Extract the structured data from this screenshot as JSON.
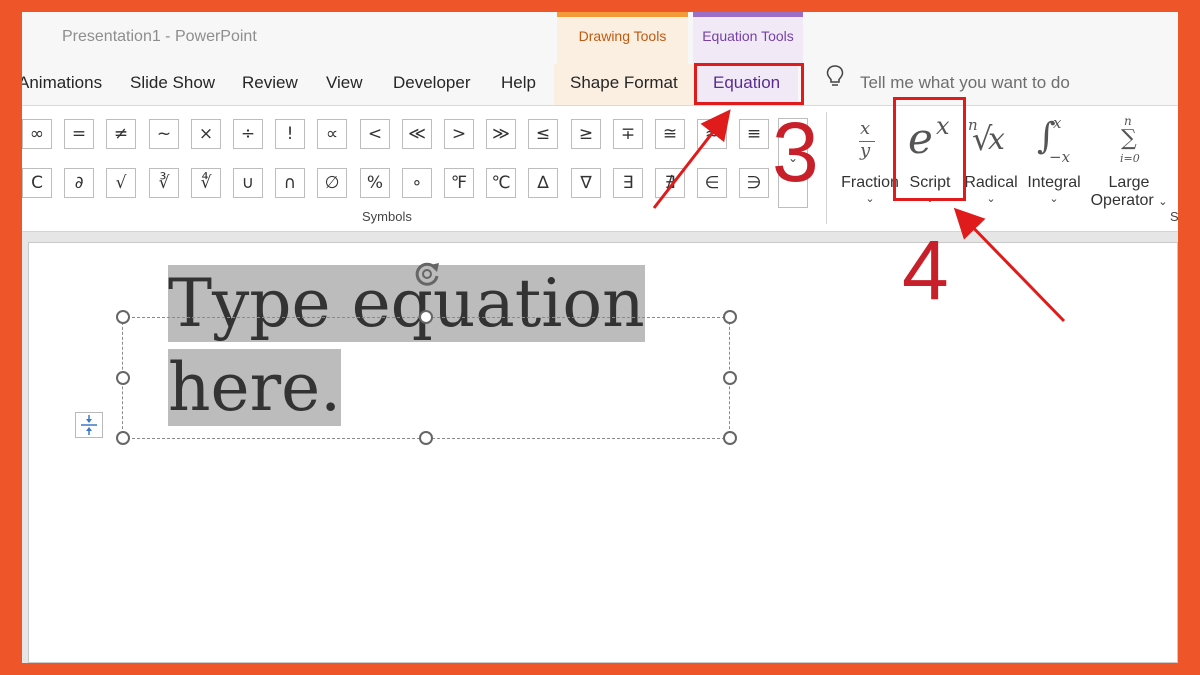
{
  "window": {
    "title": "Presentation1  -  PowerPoint"
  },
  "context_groups": {
    "drawing_tools": "Drawing Tools",
    "equation_tools": "Equation Tools"
  },
  "tabs": {
    "animations": "Animations",
    "slide_show": "Slide Show",
    "review": "Review",
    "view": "View",
    "developer": "Developer",
    "help": "Help",
    "shape_format": "Shape Format",
    "equation": "Equation"
  },
  "tell_me": {
    "placeholder": "Tell me what you want to do",
    "icon": "lightbulb-icon"
  },
  "symbols": {
    "row1": [
      "∞",
      "=",
      "≠",
      "~",
      "×",
      "÷",
      "!",
      "∝",
      "<",
      "≪",
      ">",
      "≫",
      "≤",
      "≥",
      "∓",
      "≅",
      "≈",
      "≡"
    ],
    "row2": [
      "C",
      "∂",
      "√",
      "∛",
      "∜",
      "∪",
      "∩",
      "∅",
      "%",
      "∘",
      "℉",
      "℃",
      "∆",
      "∇",
      "∃",
      "∄",
      "∈",
      "∋"
    ],
    "group_label": "Symbols"
  },
  "structures": {
    "fraction": {
      "label": "Fraction"
    },
    "script": {
      "label": "Script"
    },
    "radical": {
      "label": "Radical"
    },
    "integral": {
      "label": "Integral"
    },
    "large_operator": {
      "label_line1": "Large",
      "label_line2": "Operator"
    },
    "group_label": "S"
  },
  "equation_placeholder": "Type equation here.",
  "annotations": {
    "step3": "3",
    "step4": "4",
    "highlight_color": "#e01b1b"
  },
  "colors": {
    "frame": "#ee5528",
    "drawing_accent": "#f29b38",
    "equation_accent": "#9b6fc7"
  }
}
